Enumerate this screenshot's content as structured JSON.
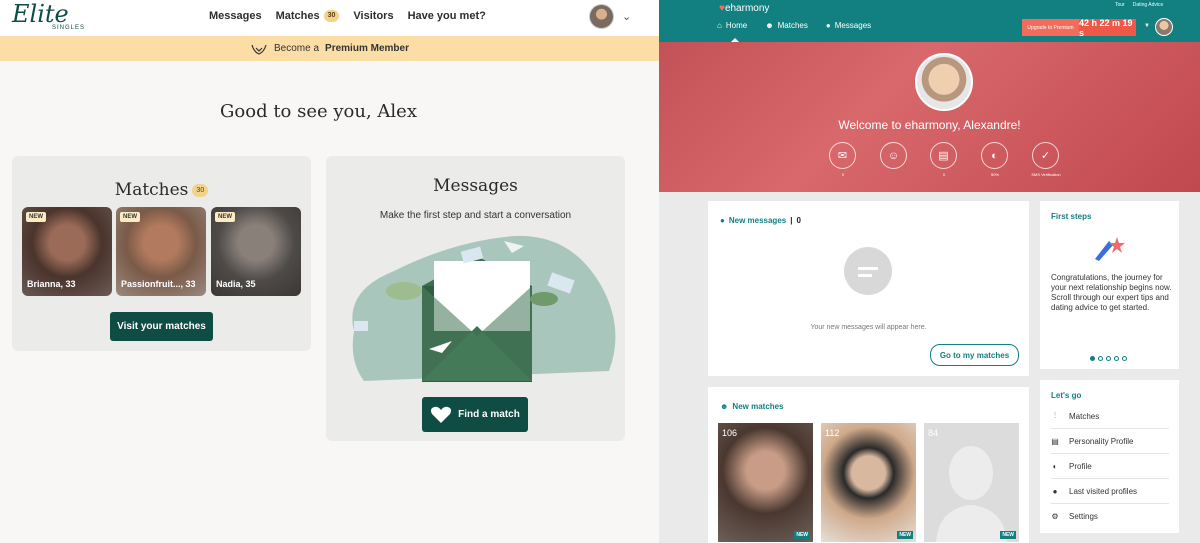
{
  "elite": {
    "logo": "Elite",
    "logo_sub": "SINGLES",
    "nav": {
      "messages": "Messages",
      "matches": "Matches",
      "matches_count": "30",
      "visitors": "Visitors",
      "have_you_met": "Have you met?"
    },
    "premium": {
      "prefix": "Become a",
      "strong": "Premium Member"
    },
    "greeting": "Good to see you, Alex",
    "matches_card": {
      "title": "Matches",
      "count": "30",
      "new_label": "NEW",
      "profiles": [
        {
          "name": "Brianna, 33"
        },
        {
          "name": "Passionfruit..., 33"
        },
        {
          "name": "Nadia, 35"
        }
      ],
      "button": "Visit your matches"
    },
    "messages_card": {
      "title": "Messages",
      "subtitle": "Make the first step and start a conversation",
      "button": "Find a match"
    }
  },
  "eharmony": {
    "logo": "eharmony",
    "top_links": [
      "Tour",
      "Dating Advice"
    ],
    "tabs": [
      {
        "label": "Home"
      },
      {
        "label": "Matches"
      },
      {
        "label": "Messages"
      }
    ],
    "upgrade": "Upgrade to Premium",
    "timer": "42 h 22 m 19 s",
    "welcome": "Welcome to eharmony, Alexandre!",
    "stat_icons": [
      {
        "label": "0"
      },
      {
        "label": ""
      },
      {
        "label": "0"
      },
      {
        "label": "50%"
      },
      {
        "label": "SMS Verification"
      }
    ],
    "new_messages": {
      "title": "New messages",
      "count": "0",
      "empty": "Your new messages will appear here.",
      "button": "Go to my matches"
    },
    "first_steps": {
      "title": "First steps",
      "text": "Congratulations, the journey for your next relationship begins now. Scroll through our expert tips and dating advice to get started.",
      "dots": 5,
      "active_dot": 0
    },
    "lets_go": {
      "title": "Let's go",
      "items": [
        "Matches",
        "Personality Profile",
        "Profile",
        "Last visited profiles",
        "Settings"
      ]
    },
    "new_matches": {
      "title": "New matches",
      "new_label": "NEW",
      "cards": [
        {
          "score": "106"
        },
        {
          "score": "112"
        },
        {
          "score": "84"
        }
      ]
    }
  }
}
